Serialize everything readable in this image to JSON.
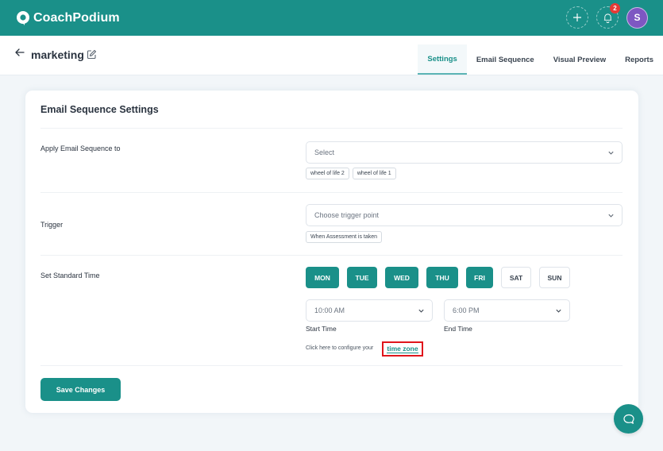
{
  "app": {
    "brand_name": "CoachPodium",
    "notification_count": "2",
    "avatar_initial": "S",
    "colors": {
      "primary": "#1a9089",
      "badge": "#e53935",
      "avatar": "#7e57c2",
      "highlight_box": "#e0161c"
    }
  },
  "header": {
    "title": "marketing",
    "icons": {
      "back": "arrow-left-icon",
      "edit": "edit-icon",
      "add": "plus-icon",
      "notifications": "bell-icon"
    }
  },
  "tabs": [
    {
      "label": "Settings",
      "active": true
    },
    {
      "label": "Email Sequence",
      "active": false
    },
    {
      "label": "Visual Preview",
      "active": false
    },
    {
      "label": "Reports",
      "active": false
    }
  ],
  "card": {
    "title": "Email Sequence Settings",
    "apply": {
      "label": "Apply Email Sequence to",
      "select_placeholder": "Select",
      "chips": [
        "wheel of life 2",
        "wheel of life 1"
      ]
    },
    "trigger": {
      "label": "Trigger",
      "select_placeholder": "Choose trigger point",
      "chips": [
        "When Assessment is taken"
      ]
    },
    "standard_time": {
      "label": "Set Standard Time",
      "days": [
        {
          "label": "MON",
          "selected": true
        },
        {
          "label": "TUE",
          "selected": true
        },
        {
          "label": "WED",
          "selected": true
        },
        {
          "label": "THU",
          "selected": true
        },
        {
          "label": "FRI",
          "selected": true
        },
        {
          "label": "SAT",
          "selected": false
        },
        {
          "label": "SUN",
          "selected": false
        }
      ],
      "start_time_value": "10:00 AM",
      "start_time_label": "Start Time",
      "end_time_value": "6:00 PM",
      "end_time_label": "End Time",
      "timezone_text": "Click here to configure your",
      "timezone_link": "time zone"
    },
    "save_label": "Save Changes"
  },
  "chat": {
    "icon": "chat-bubble-icon"
  }
}
